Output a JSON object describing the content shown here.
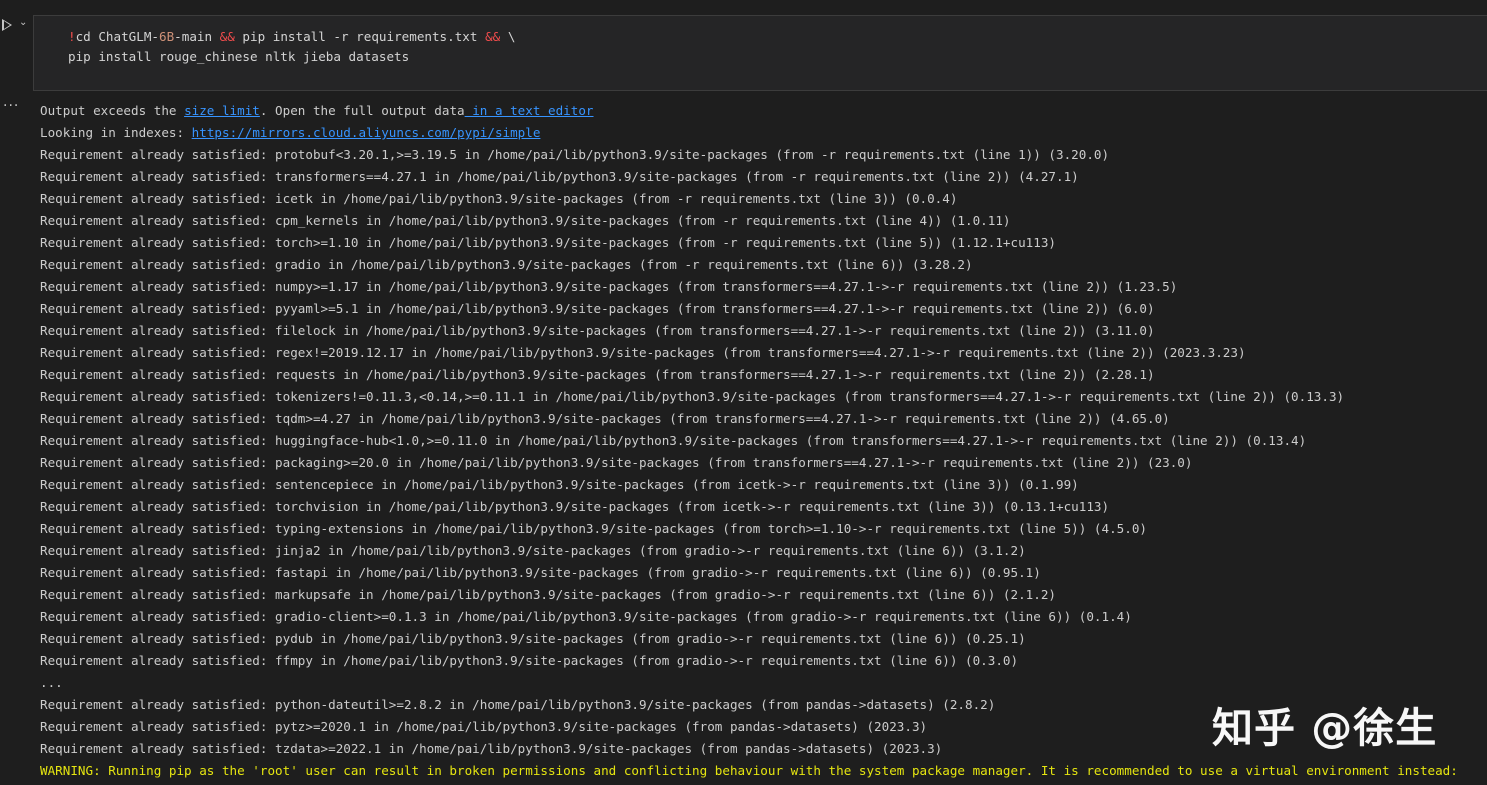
{
  "cell": {
    "code_lines": [
      [
        {
          "t": "!",
          "c": "red"
        },
        {
          "t": "cd ChatGLM-",
          "c": "white"
        },
        {
          "t": "6B",
          "c": "num"
        },
        {
          "t": "-main ",
          "c": "white"
        },
        {
          "t": "&&",
          "c": "red"
        },
        {
          "t": " pip install -r requirements.txt ",
          "c": "white"
        },
        {
          "t": "&&",
          "c": "red"
        },
        {
          "t": " \\",
          "c": "white"
        }
      ],
      [
        {
          "t": "pip install rouge_chinese nltk jieba datasets",
          "c": "white"
        }
      ]
    ],
    "run_chevron": "⌄",
    "output_menu": "···"
  },
  "output": {
    "size_notice": {
      "prefix": "Output exceeds the ",
      "link1": "size limit",
      "middle": ". Open the full output data",
      "link2": " in a text editor"
    },
    "index_prefix": "Looking in indexes: ",
    "index_url": "https://mirrors.cloud.aliyuncs.com/pypi/simple",
    "lines_before": [
      "Requirement already satisfied: protobuf<3.20.1,>=3.19.5 in /home/pai/lib/python3.9/site-packages (from -r requirements.txt (line 1)) (3.20.0)",
      "Requirement already satisfied: transformers==4.27.1 in /home/pai/lib/python3.9/site-packages (from -r requirements.txt (line 2)) (4.27.1)",
      "Requirement already satisfied: icetk in /home/pai/lib/python3.9/site-packages (from -r requirements.txt (line 3)) (0.0.4)",
      "Requirement already satisfied: cpm_kernels in /home/pai/lib/python3.9/site-packages (from -r requirements.txt (line 4)) (1.0.11)",
      "Requirement already satisfied: torch>=1.10 in /home/pai/lib/python3.9/site-packages (from -r requirements.txt (line 5)) (1.12.1+cu113)",
      "Requirement already satisfied: gradio in /home/pai/lib/python3.9/site-packages (from -r requirements.txt (line 6)) (3.28.2)",
      "Requirement already satisfied: numpy>=1.17 in /home/pai/lib/python3.9/site-packages (from transformers==4.27.1->-r requirements.txt (line 2)) (1.23.5)",
      "Requirement already satisfied: pyyaml>=5.1 in /home/pai/lib/python3.9/site-packages (from transformers==4.27.1->-r requirements.txt (line 2)) (6.0)",
      "Requirement already satisfied: filelock in /home/pai/lib/python3.9/site-packages (from transformers==4.27.1->-r requirements.txt (line 2)) (3.11.0)",
      "Requirement already satisfied: regex!=2019.12.17 in /home/pai/lib/python3.9/site-packages (from transformers==4.27.1->-r requirements.txt (line 2)) (2023.3.23)",
      "Requirement already satisfied: requests in /home/pai/lib/python3.9/site-packages (from transformers==4.27.1->-r requirements.txt (line 2)) (2.28.1)",
      "Requirement already satisfied: tokenizers!=0.11.3,<0.14,>=0.11.1 in /home/pai/lib/python3.9/site-packages (from transformers==4.27.1->-r requirements.txt (line 2)) (0.13.3)",
      "Requirement already satisfied: tqdm>=4.27 in /home/pai/lib/python3.9/site-packages (from transformers==4.27.1->-r requirements.txt (line 2)) (4.65.0)",
      "Requirement already satisfied: huggingface-hub<1.0,>=0.11.0 in /home/pai/lib/python3.9/site-packages (from transformers==4.27.1->-r requirements.txt (line 2)) (0.13.4)",
      "Requirement already satisfied: packaging>=20.0 in /home/pai/lib/python3.9/site-packages (from transformers==4.27.1->-r requirements.txt (line 2)) (23.0)",
      "Requirement already satisfied: sentencepiece in /home/pai/lib/python3.9/site-packages (from icetk->-r requirements.txt (line 3)) (0.1.99)",
      "Requirement already satisfied: torchvision in /home/pai/lib/python3.9/site-packages (from icetk->-r requirements.txt (line 3)) (0.13.1+cu113)",
      "Requirement already satisfied: typing-extensions in /home/pai/lib/python3.9/site-packages (from torch>=1.10->-r requirements.txt (line 5)) (4.5.0)",
      "Requirement already satisfied: jinja2 in /home/pai/lib/python3.9/site-packages (from gradio->-r requirements.txt (line 6)) (3.1.2)",
      "Requirement already satisfied: fastapi in /home/pai/lib/python3.9/site-packages (from gradio->-r requirements.txt (line 6)) (0.95.1)",
      "Requirement already satisfied: markupsafe in /home/pai/lib/python3.9/site-packages (from gradio->-r requirements.txt (line 6)) (2.1.2)",
      "Requirement already satisfied: gradio-client>=0.1.3 in /home/pai/lib/python3.9/site-packages (from gradio->-r requirements.txt (line 6)) (0.1.4)",
      "Requirement already satisfied: pydub in /home/pai/lib/python3.9/site-packages (from gradio->-r requirements.txt (line 6)) (0.25.1)",
      "Requirement already satisfied: ffmpy in /home/pai/lib/python3.9/site-packages (from gradio->-r requirements.txt (line 6)) (0.3.0)"
    ],
    "truncation": "...",
    "lines_after": [
      "Requirement already satisfied: python-dateutil>=2.8.2 in /home/pai/lib/python3.9/site-packages (from pandas->datasets) (2.8.2)",
      "Requirement already satisfied: pytz>=2020.1 in /home/pai/lib/python3.9/site-packages (from pandas->datasets) (2023.3)",
      "Requirement already satisfied: tzdata>=2022.1 in /home/pai/lib/python3.9/site-packages (from pandas->datasets) (2023.3)"
    ],
    "warning": "WARNING: Running pip as the 'root' user can result in broken permissions and conflicting behaviour with the system package manager. It is recommended to use a virtual environment instead:"
  },
  "watermark": "知乎 @徐生",
  "colors": {
    "background": "#1e1e1e",
    "editor_bg": "#252526",
    "text": "#cccccc",
    "link": "#3794ff",
    "warning": "#e5e510",
    "keyword_red": "#f14c4c",
    "number": "#ce9178"
  }
}
